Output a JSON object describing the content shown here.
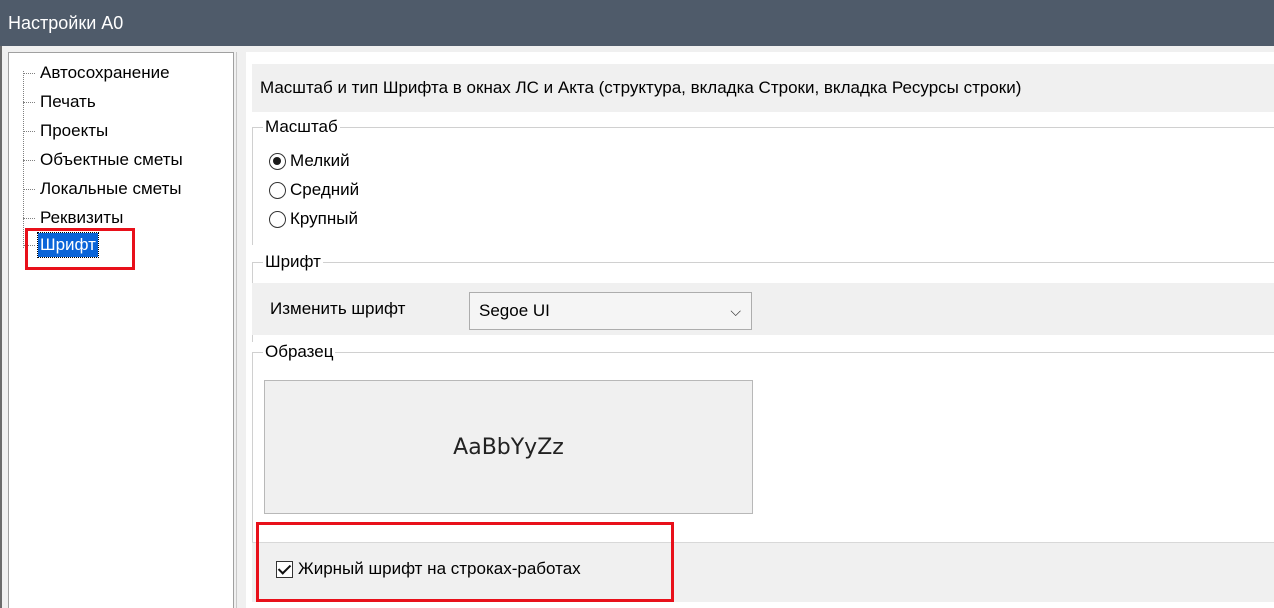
{
  "window": {
    "title": "Настройки А0"
  },
  "sidebar": {
    "items": [
      {
        "label": "Автосохранение"
      },
      {
        "label": "Печать"
      },
      {
        "label": "Проекты"
      },
      {
        "label": "Объектные сметы"
      },
      {
        "label": "Локальные сметы"
      },
      {
        "label": "Реквизиты"
      },
      {
        "label": "Шрифт",
        "selected": true
      }
    ]
  },
  "main": {
    "header": "Масштаб и тип Шрифта в окнах ЛС и Акта (структура, вкладка Строки, вкладка Ресурсы строки)",
    "scale": {
      "title": "Масштаб",
      "options": [
        {
          "label": "Мелкий",
          "checked": true
        },
        {
          "label": "Средний",
          "checked": false
        },
        {
          "label": "Крупный",
          "checked": false
        }
      ]
    },
    "font": {
      "title": "Шрифт",
      "change_label": "Изменить шрифт",
      "selected_font": "Segoe UI"
    },
    "sample": {
      "title": "Образец",
      "text": "AaBbYyZz"
    },
    "bold_rows": {
      "label": "Жирный шрифт на строках-работах",
      "checked": true
    }
  },
  "colors": {
    "titlebar": "#4f5b6a",
    "selection": "#0a64d8",
    "highlight_box": "#e8101a"
  }
}
